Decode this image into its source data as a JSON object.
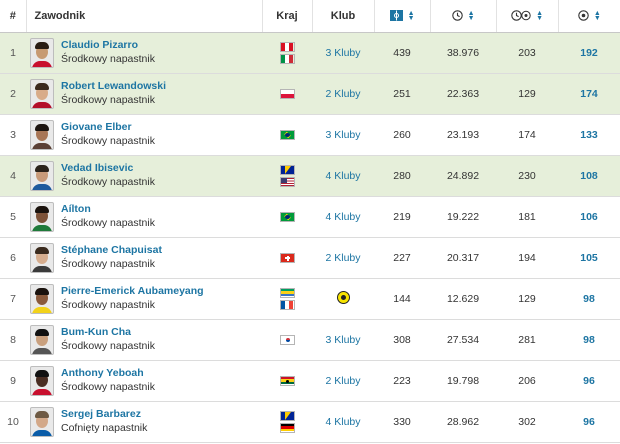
{
  "header": {
    "rank": "#",
    "player": "Zawodnik",
    "country": "Kraj",
    "club": "Klub",
    "appearances_icon": "appearances-icon",
    "minutes_icon": "clock-icon",
    "minutes_per_goal_icon": "clock-ball-icon",
    "goals_icon": "ball-icon"
  },
  "colors": {
    "link": "#1d75a3",
    "highlight_row": "#e6efda"
  },
  "rows": [
    {
      "rank": "1",
      "name": "Claudio Pizarro",
      "position": "Środkowy napastnik",
      "flags": [
        "peru",
        "italy"
      ],
      "club": "3 Kluby",
      "apps": "439",
      "minutes": "38.976",
      "min_per_goal": "203",
      "goals": "192",
      "highlight": true,
      "photo": {
        "skin": "#c79a72",
        "hair": "#2a1d14",
        "shirt": "#c8102e"
      }
    },
    {
      "rank": "2",
      "name": "Robert Lewandowski",
      "position": "Środkowy napastnik",
      "flags": [
        "poland"
      ],
      "club": "2 Kluby",
      "apps": "251",
      "minutes": "22.363",
      "min_per_goal": "129",
      "goals": "174",
      "highlight": true,
      "photo": {
        "skin": "#d8ab89",
        "hair": "#3b2a1e",
        "shirt": "#b40f2a"
      }
    },
    {
      "rank": "3",
      "name": "Giovane Elber",
      "position": "Środkowy napastnik",
      "flags": [
        "brazil"
      ],
      "club": "3 Kluby",
      "apps": "260",
      "minutes": "23.193",
      "min_per_goal": "174",
      "goals": "133",
      "highlight": false,
      "photo": {
        "skin": "#a87656",
        "hair": "#1d1510",
        "shirt": "#5a4036"
      }
    },
    {
      "rank": "4",
      "name": "Vedad Ibisevic",
      "position": "Środkowy napastnik",
      "flags": [
        "bosnia",
        "usa"
      ],
      "club": "4 Kluby",
      "apps": "280",
      "minutes": "24.892",
      "min_per_goal": "230",
      "goals": "108",
      "highlight": true,
      "photo": {
        "skin": "#c89a7a",
        "hair": "#2b221b",
        "shirt": "#1e5a9e"
      }
    },
    {
      "rank": "5",
      "name": "Aílton",
      "position": "Środkowy napastnik",
      "flags": [
        "brazil"
      ],
      "club": "4 Kluby",
      "apps": "219",
      "minutes": "19.222",
      "min_per_goal": "181",
      "goals": "106",
      "highlight": false,
      "photo": {
        "skin": "#7d5238",
        "hair": "#1a120d",
        "shirt": "#1f7a3a"
      }
    },
    {
      "rank": "6",
      "name": "Stéphane Chapuisat",
      "position": "Środkowy napastnik",
      "flags": [
        "switzerland"
      ],
      "club": "2 Kluby",
      "apps": "227",
      "minutes": "20.317",
      "min_per_goal": "194",
      "goals": "105",
      "highlight": false,
      "photo": {
        "skin": "#d6ad8e",
        "hair": "#3a2a1d",
        "shirt": "#3b3b3b"
      }
    },
    {
      "rank": "7",
      "name": "Pierre-Emerick Aubameyang",
      "position": "Środkowy napastnik",
      "flags": [
        "gabon",
        "france"
      ],
      "club": "",
      "apps": "144",
      "minutes": "12.629",
      "min_per_goal": "129",
      "goals": "98",
      "highlight": false,
      "photo": {
        "skin": "#8a5a3c",
        "hair": "#1a120d",
        "shirt": "#f2d21b"
      }
    },
    {
      "rank": "8",
      "name": "Bum-Kun Cha",
      "position": "Środkowy napastnik",
      "flags": [
        "korea"
      ],
      "club": "3 Kluby",
      "apps": "308",
      "minutes": "27.534",
      "min_per_goal": "281",
      "goals": "98",
      "highlight": false,
      "photo": {
        "skin": "#c9a07e",
        "hair": "#111111",
        "shirt": "#555555"
      }
    },
    {
      "rank": "9",
      "name": "Anthony Yeboah",
      "position": "Środkowy napastnik",
      "flags": [
        "ghana"
      ],
      "club": "2 Kluby",
      "apps": "223",
      "minutes": "19.798",
      "min_per_goal": "206",
      "goals": "96",
      "highlight": false,
      "photo": {
        "skin": "#4a2e22",
        "hair": "#111111",
        "shirt": "#c8102e"
      }
    },
    {
      "rank": "10",
      "name": "Sergej Barbarez",
      "position": "Cofnięty napastnik",
      "flags": [
        "bosnia",
        "germany"
      ],
      "club": "4 Kluby",
      "apps": "330",
      "minutes": "28.962",
      "min_per_goal": "302",
      "goals": "96",
      "highlight": false,
      "photo": {
        "skin": "#d3a888",
        "hair": "#6e5a44",
        "shirt": "#0a5ca8"
      }
    }
  ]
}
